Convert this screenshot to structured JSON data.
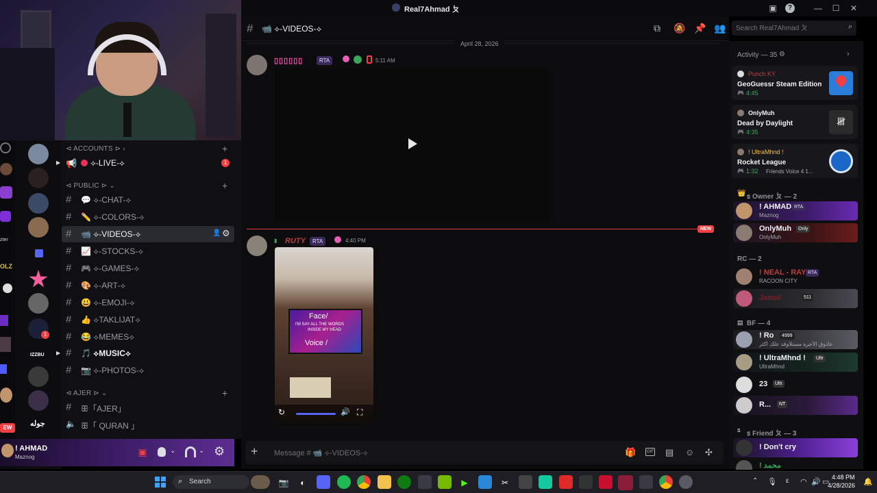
{
  "window": {
    "title": "Real7Ahmad ㄆ"
  },
  "webcam": {
    "label": "streamer webcam"
  },
  "server_bar": {
    "left_labels": [
      "zter",
      "OLZ"
    ],
    "badges": [
      "1"
    ],
    "bottom_label": "جوله",
    "side_text": "IZZBU",
    "new_badge": "EW"
  },
  "channels": {
    "categories": [
      {
        "label": "⊲ ACCOUNTS ⊳ ›"
      },
      {
        "label": "⊲ PUBLIC ⊳ ⌄"
      },
      {
        "label": "⊲ AJER ⊳ ⌄"
      }
    ],
    "live": {
      "label": "⟡-LIVE-⟡",
      "badge": "1"
    },
    "list": [
      {
        "label": "💬 ⟡-CHAT-⟡"
      },
      {
        "label": "✏️ ⟡-COLORS-⟡"
      },
      {
        "label": "📹 ⟡-VIDEOS-⟡"
      },
      {
        "label": "📈 ⟡-STOCKS-⟡"
      },
      {
        "label": "🎮 ⟡-GAMES-⟡"
      },
      {
        "label": "🎨 ⟡-ART-⟡"
      },
      {
        "label": "😃 ⟡-EMOJI-⟡"
      },
      {
        "label": "👍 ⟡TAKLIJAT⟡"
      },
      {
        "label": "😂 ⟡MEMES⟡"
      },
      {
        "label": "🎵 ⟡MUSIC⟡"
      },
      {
        "label": "📷 ⟡-PHOTOS-⟡"
      },
      {
        "label": "ꕥ「AJER」"
      },
      {
        "label": "ꕥ「 QURAN 」"
      }
    ]
  },
  "user_panel": {
    "name": "! AHMAD",
    "status": "Maznog"
  },
  "chat": {
    "channel_name": "📹 ⟡-VIDEOS-⟡",
    "date_divider": "April 28, 2026",
    "new_label": "NEW",
    "messages": [
      {
        "author": "▯▯▯▯▯▯",
        "tag": "RTA",
        "time": "5:11 AM"
      },
      {
        "author": "RUTY",
        "tag": "RTA",
        "time": "4:40 PM"
      }
    ],
    "video_overlay": {
      "line1": "Face/",
      "line2": "I'M SAY ALL THE WORDS",
      "line3": "INSIDE MY HEAD",
      "line4": "Voice /"
    },
    "input_placeholder": "Message # 📹 ⟡-VIDEOS-⟡"
  },
  "search": {
    "placeholder": "Search Real7Ahmad ㄆ"
  },
  "activity": {
    "header": "Activity — 35",
    "cards": [
      {
        "user": "Punch KY",
        "game": "GeoGuessr Steam Edition",
        "time": "4:45",
        "extra": ""
      },
      {
        "user": "OnlyMuh",
        "game": "Dead by Daylight",
        "time": "4:35",
        "extra": ""
      },
      {
        "user": "! UltraMhnd !",
        "game": "Rocket League",
        "time": "1:32",
        "extra": "Friends Voice 4 1..."
      }
    ]
  },
  "members": {
    "groups": [
      {
        "label": "ꜱ Owner ㄆ — 2"
      },
      {
        "label": "RC — 2"
      },
      {
        "label": "BF — 4"
      },
      {
        "label": "ꜱ Friend ㄆ — 3"
      }
    ],
    "items": [
      {
        "name": "! AHMAD",
        "tag": "RTA",
        "sub": "Maznog"
      },
      {
        "name": "OnlyMuh",
        "tag": "Only",
        "sub": "OnlyMuh"
      },
      {
        "name": "! NEAL - RAY",
        "tag": "RTA",
        "sub": "RACOON CITY"
      },
      {
        "name": "Jamal",
        "tag": "511",
        "sub": ""
      },
      {
        "name": "! Ro",
        "tag": "4999",
        "sub": "عاذوق الأجره مستلاوقد علك اكثر"
      },
      {
        "name": "! UltraMhnd !",
        "tag": "Ultr",
        "sub": "UltraMhnd"
      },
      {
        "name": "23",
        "tag": "Ultr",
        "sub": ""
      },
      {
        "name": "R...",
        "tag": "NT",
        "sub": ""
      },
      {
        "name": "! Don't cry",
        "tag": "",
        "sub": ""
      },
      {
        "name": "! محمد",
        "tag": "",
        "sub": ""
      }
    ]
  },
  "taskbar": {
    "search_label": "Search",
    "time": "4:48 PM",
    "date": "4/28/2026",
    "lang": "ε"
  },
  "colors": {
    "accent": "#5865f2",
    "new": "#f23f43",
    "ruty": "#c03c3c"
  }
}
